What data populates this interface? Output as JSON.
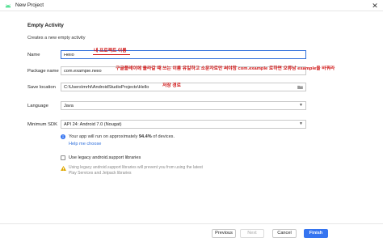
{
  "window": {
    "title": "New Project",
    "close_glyph": "✕"
  },
  "page": {
    "heading": "Empty Activity",
    "subheading": "Creates a new empty activity"
  },
  "form": {
    "name_label": "Name",
    "name_value": "Hello",
    "package_label": "Package name",
    "package_value": "com.example.hello",
    "save_label": "Save location",
    "save_value": "C:\\Users\\mrhi\\AndroidStudioProjects\\Hello",
    "language_label": "Language",
    "language_value": "Java",
    "sdk_label": "Minimum SDK",
    "sdk_value": "API 24: Android 7.0 (Nougat)"
  },
  "annotations": {
    "name_note": "내 프로젝트 이름",
    "package_note": "구글플레이에 올라갈 때 쓰는 이름 유일하고 소문자로만 써야함 com.example 로하면 오류남 example을 바꿔라",
    "save_note": "저장 경로"
  },
  "info": {
    "text_prefix": "Your app will run on approximately ",
    "percent": "94.4%",
    "text_suffix": " of devices.",
    "help_link": "Help me choose"
  },
  "legacy": {
    "checkbox_label": "Use legacy android.support libraries",
    "checked": false,
    "warning": "Using legacy android.support libraries will prevent you from using the latest Play Services and Jetpack libraries"
  },
  "footer": {
    "previous": "Previous",
    "next": "Next",
    "cancel": "Cancel",
    "finish": "Finish"
  },
  "colors": {
    "accent": "#3574f0",
    "annotation": "#d01414",
    "android_green": "#3ddc84",
    "warning": "#e0a800"
  },
  "icons": {
    "app": "android-icon",
    "close": "close-icon",
    "folder": "folder-icon",
    "info": "info-icon",
    "warning": "warning-icon",
    "dropdown": "chevron-down-icon"
  }
}
